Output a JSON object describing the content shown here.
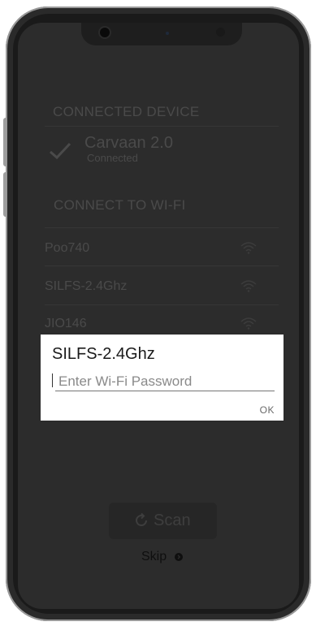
{
  "connected_section": {
    "title": "CONNECTED DEVICE",
    "device_name": "Carvaan 2.0",
    "device_status": "Connected"
  },
  "wifi_section": {
    "title": "CONNECT TO WI-FI",
    "networks": [
      {
        "name": "Poo740"
      },
      {
        "name": "SILFS-2.4Ghz"
      },
      {
        "name": "JIO146"
      }
    ]
  },
  "dialog": {
    "title": "SILFS-2.4Ghz",
    "password_placeholder": "Enter Wi-Fi Password",
    "ok_label": "OK"
  },
  "actions": {
    "scan_label": "Scan",
    "skip_label": "Skip"
  },
  "icons": {
    "check": "check-icon",
    "wifi": "wifi-icon",
    "refresh": "refresh-icon",
    "arrow": "arrow-circle-icon"
  },
  "colors": {
    "overlay_bg": "#2c2c2c",
    "dim_text": "#4a4a4a",
    "dialog_bg": "#ffffff",
    "accent_line": "#757575"
  }
}
